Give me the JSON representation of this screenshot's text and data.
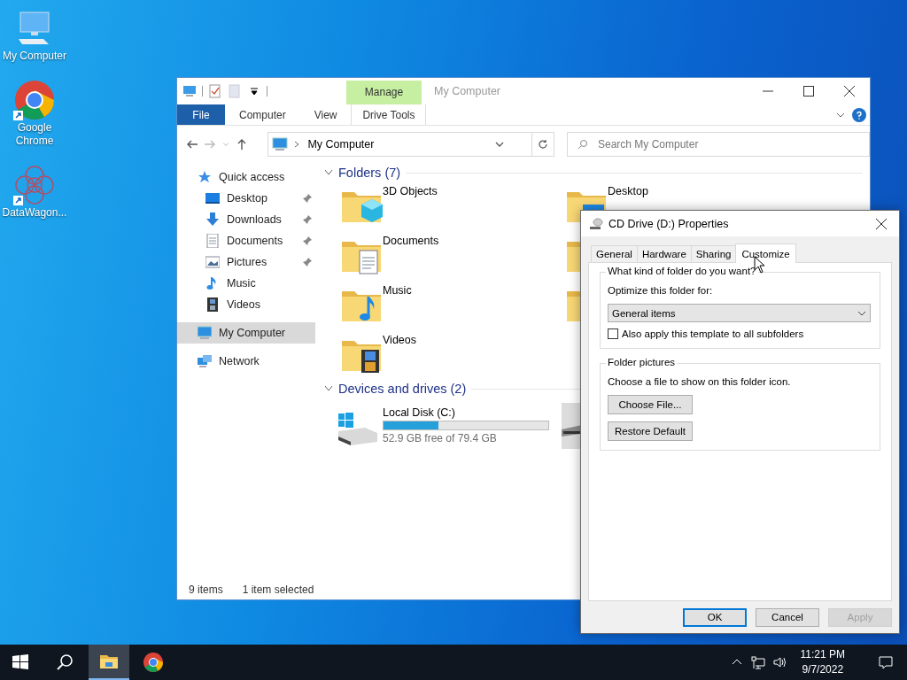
{
  "desktop_icons": [
    {
      "label": "My Computer",
      "kind": "computer",
      "shortcut": false
    },
    {
      "label": "Google Chrome",
      "kind": "chrome",
      "shortcut": true
    },
    {
      "label": "DataWagon...",
      "kind": "app",
      "shortcut": true
    }
  ],
  "explorer": {
    "title": "My Computer",
    "quick_access_toolbar": [
      {
        "kind": "computer"
      },
      {
        "kind": "properties"
      },
      {
        "kind": "new-folder"
      },
      {
        "kind": "dropdown"
      }
    ],
    "context_group": "Manage",
    "ribbon_tabs": [
      {
        "label": "File",
        "kind": "file"
      },
      {
        "label": "Computer",
        "kind": "tab"
      },
      {
        "label": "View",
        "kind": "tab"
      },
      {
        "label": "Drive Tools",
        "kind": "context"
      }
    ],
    "address": "My Computer",
    "search": {
      "placeholder": "Search My Computer"
    },
    "nav": [
      {
        "label": "Quick access",
        "kind": "star",
        "selected": false,
        "children": [
          {
            "label": "Desktop",
            "kind": "desktop",
            "pinned": true,
            "selected": false
          },
          {
            "label": "Downloads",
            "kind": "downloads",
            "pinned": true,
            "selected": false
          },
          {
            "label": "Documents",
            "kind": "documents",
            "pinned": true,
            "selected": false
          },
          {
            "label": "Pictures",
            "kind": "pictures",
            "pinned": true,
            "selected": false
          },
          {
            "label": "Music",
            "kind": "music",
            "pinned": false,
            "selected": false
          },
          {
            "label": "Videos",
            "kind": "videos",
            "pinned": false,
            "selected": false
          }
        ]
      },
      {
        "label": "My Computer",
        "kind": "computer",
        "selected": true
      },
      {
        "label": "Network",
        "kind": "network",
        "selected": false
      }
    ],
    "folders": {
      "title": "Folders (7)",
      "items": [
        {
          "label": "3D Objects",
          "kind": "objects"
        },
        {
          "label": "Desktop",
          "kind": "desktop"
        },
        {
          "label": "Documents",
          "kind": "documents"
        },
        {
          "kind": "downloads"
        },
        {
          "label": "Music",
          "kind": "music"
        },
        {
          "kind": "pictures"
        },
        {
          "label": "Videos",
          "kind": "videos"
        }
      ]
    },
    "drives": {
      "title": "Devices and drives (2)",
      "items": [
        {
          "name": "Local Disk (C:)",
          "kind": "system",
          "level": 0.334,
          "free": "52.9 GB free of 79.4 GB",
          "selected": false
        },
        {
          "kind": "cd",
          "selected": true
        }
      ]
    },
    "status_bar": [
      "9 items",
      "1 item selected"
    ]
  },
  "dialog": {
    "title": "CD Drive (D:) Properties",
    "tabs": [
      {
        "label": "General",
        "selected": false
      },
      {
        "label": "Hardware",
        "selected": false
      },
      {
        "label": "Sharing",
        "selected": false
      },
      {
        "label": "Customize",
        "selected": true
      }
    ],
    "group_1": {
      "title": "What kind of folder do you want?",
      "label": "Optimize this folder for:",
      "select_value": "General items",
      "checkbox": {
        "label": "Also apply this template to all subfolders",
        "checked": false
      }
    },
    "group_2": {
      "title": "Folder pictures",
      "text": "Choose a file to show on this folder icon.",
      "buttons": [
        "Choose File...",
        "Restore Default"
      ]
    },
    "buttons": [
      {
        "label": "OK",
        "default": true,
        "disabled": false
      },
      {
        "label": "Cancel",
        "default": false,
        "disabled": false
      },
      {
        "label": "Apply",
        "default": false,
        "disabled": true
      }
    ]
  },
  "taskbar": {
    "apps": [
      {
        "kind": "start",
        "selected": false
      },
      {
        "kind": "search",
        "selected": false
      },
      {
        "kind": "explorer",
        "selected": true
      },
      {
        "kind": "chrome",
        "selected": false
      }
    ],
    "time": "11:21 PM",
    "date": "9/7/2022"
  }
}
